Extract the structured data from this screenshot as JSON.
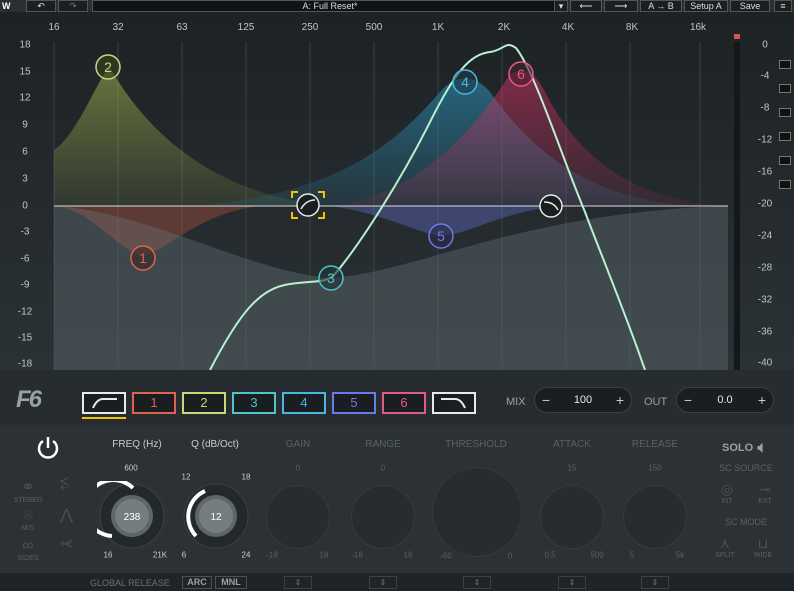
{
  "topbar": {
    "undo_icon": "undo-icon",
    "redo_icon": "redo-icon",
    "preset_name": "A: Full Reset*",
    "prev_icon": "arrow-left-icon",
    "next_icon": "arrow-right-icon",
    "ab_label": "A → B",
    "setup_label": "Setup A",
    "save_label": "Save"
  },
  "graph": {
    "freq_labels": [
      "16",
      "32",
      "63",
      "125",
      "250",
      "500",
      "1K",
      "2K",
      "4K",
      "8K",
      "16k"
    ],
    "left_db": [
      "18",
      "15",
      "12",
      "9",
      "6",
      "3",
      "0",
      "-3",
      "-6",
      "-9",
      "-12",
      "-15",
      "-18"
    ],
    "right_db": [
      "0",
      "-4",
      "-8",
      "-12",
      "-16",
      "-20",
      "-24",
      "-28",
      "-32",
      "-36",
      "-40"
    ],
    "nodes": [
      {
        "label": "1",
        "color": "#e0634f"
      },
      {
        "label": "2",
        "color": "#c5d97a"
      },
      {
        "label": "3",
        "color": "#4fc4c9"
      },
      {
        "label": "4",
        "color": "#49b8de"
      },
      {
        "label": "5",
        "color": "#6f78e6"
      },
      {
        "label": "6",
        "color": "#e05b86"
      }
    ]
  },
  "bands": {
    "logo": "F6",
    "buttons": [
      {
        "label": "",
        "color": "#e8eaea",
        "icon": "highpass-icon"
      },
      {
        "label": "1",
        "color": "#e0634f"
      },
      {
        "label": "2",
        "color": "#c5d97a"
      },
      {
        "label": "3",
        "color": "#4fc4c9"
      },
      {
        "label": "4",
        "color": "#49b8de"
      },
      {
        "label": "5",
        "color": "#6f78e6"
      },
      {
        "label": "6",
        "color": "#e05b86"
      },
      {
        "label": "",
        "color": "#e8eaea",
        "icon": "lowpass-icon"
      }
    ],
    "mix_label": "MIX",
    "mix_value": "100",
    "out_label": "OUT",
    "out_value": "0.0"
  },
  "controls": {
    "mode_labels": [
      "STEREO",
      "M/S",
      "SIDES"
    ],
    "freq_label": "FREQ (Hz)",
    "freq_value": "238",
    "freq_top": "600",
    "freq_min": "16",
    "freq_max": "21K",
    "q_label": "Q (dB/Oct)",
    "q_value": "12",
    "q_tl": "12",
    "q_tr": "18",
    "q_min": "6",
    "q_max": "24",
    "gain_label": "GAIN",
    "gain_top": "0",
    "gain_min": "-18",
    "gain_max": "18",
    "range_label": "RANGE",
    "range_top": "0",
    "range_min": "-18",
    "range_max": "18",
    "threshold_label": "THRESHOLD",
    "threshold_min": "-60",
    "threshold_max": "0",
    "attack_label": "ATTACK",
    "attack_top": "15",
    "attack_min": "0.5",
    "attack_max": "500",
    "release_label": "RELEASE",
    "release_top": "150",
    "release_min": "5",
    "release_max": "5k",
    "solo_label": "SOLO",
    "sc_source_label": "SC SOURCE",
    "int_label": "INT",
    "ext_label": "EXT",
    "sc_mode_label": "SC MODE",
    "split_label": "SPLIT",
    "wide_label": "WIDE"
  },
  "footer": {
    "global_release_label": "GLOBAL RELEASE",
    "arc_label": "ARC",
    "mnl_label": "MNL"
  }
}
